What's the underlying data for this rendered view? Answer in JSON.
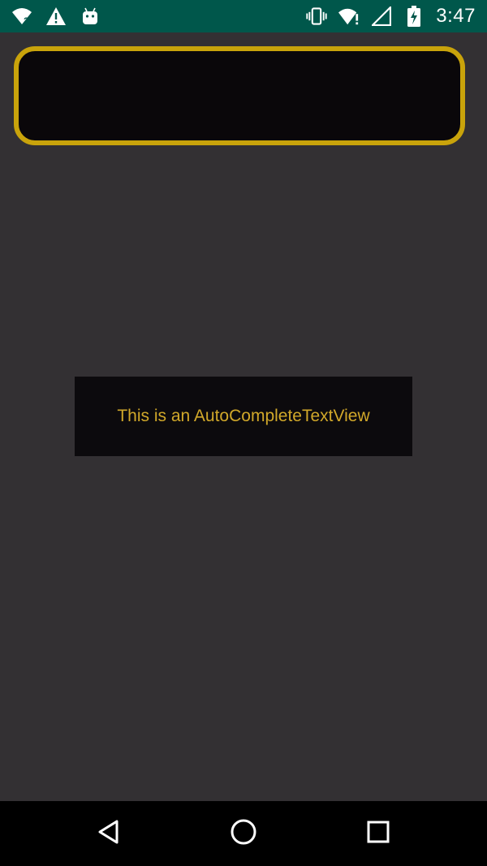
{
  "status_bar": {
    "time": "3:47",
    "background_color": "#00574B",
    "left_icons": [
      "wifi-unknown-icon",
      "warning-icon",
      "android-icon"
    ],
    "right_icons": [
      "vibrate-icon",
      "wifi-alert-icon",
      "signal-icon",
      "battery-charging-icon"
    ]
  },
  "autocomplete": {
    "value": "",
    "placeholder": "",
    "border_color": "#c9a30b",
    "background_color": "#0a070a"
  },
  "toast": {
    "message": "This is an AutoCompleteTextView",
    "text_color": "#d1a82a"
  },
  "nav_bar": {
    "buttons": [
      "back-icon",
      "home-icon",
      "recents-icon"
    ]
  }
}
